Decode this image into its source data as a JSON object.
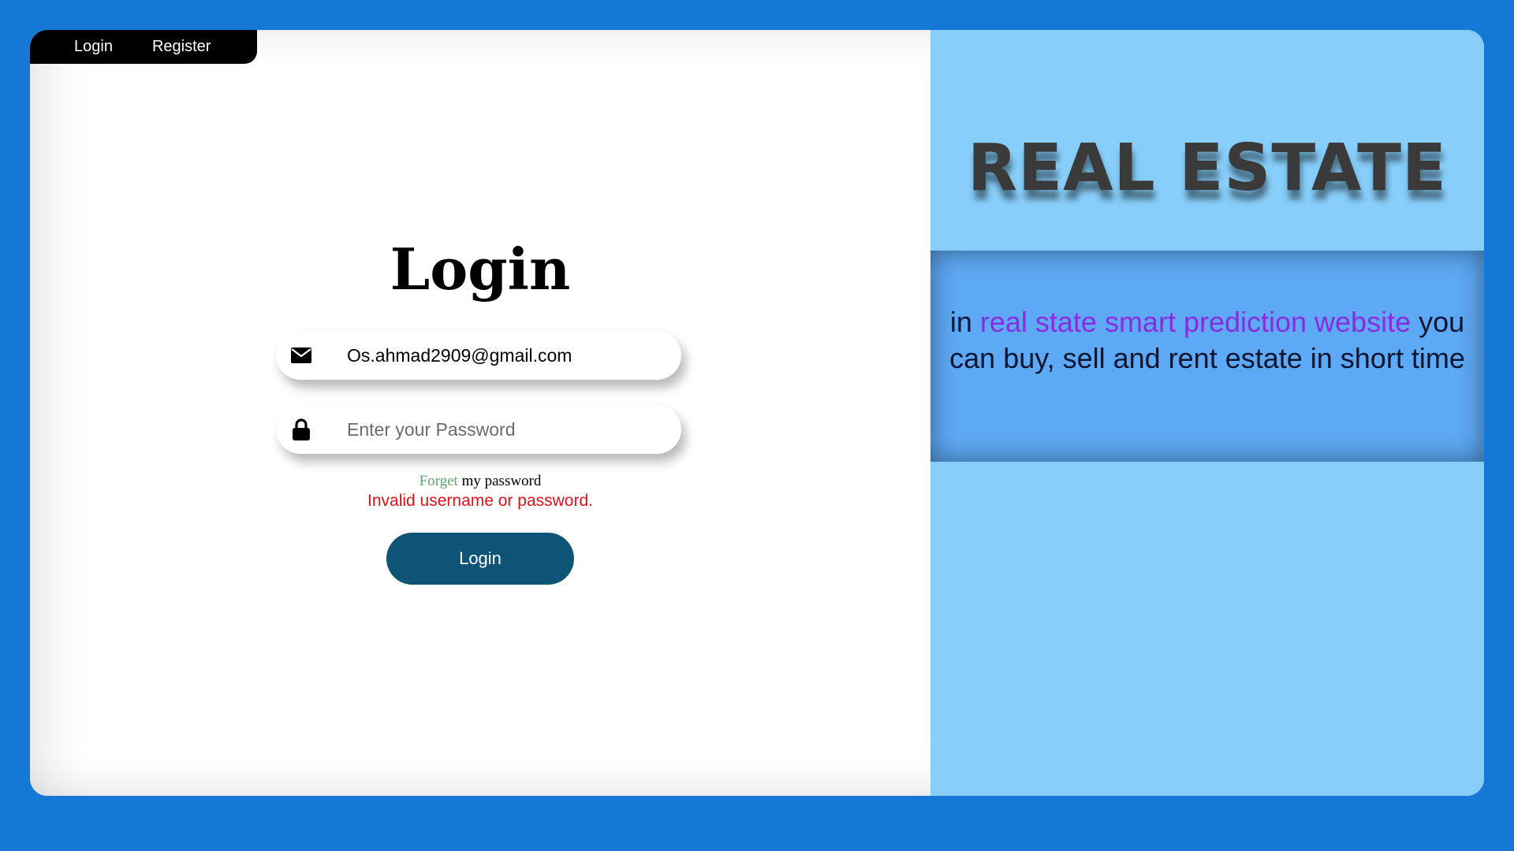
{
  "nav": {
    "login_label": "Login",
    "register_label": "Register"
  },
  "login_form": {
    "title": "Login",
    "email_value": "Os.ahmad2909@gmail.com",
    "password_placeholder": "Enter your Password",
    "forgot_link": "Forget",
    "forgot_rest": " my password",
    "error_message": "Invalid username or password.",
    "submit_label": "Login"
  },
  "brand": {
    "title": "REAL ESTATE",
    "tagline_prefix": "in ",
    "tagline_highlight": "real state smart prediction website",
    "tagline_rest": " you can buy, sell and rent estate in short time"
  },
  "colors": {
    "background": "#1478d4",
    "right_panel": "#87cefa",
    "tagline_box": "#5ea9f5",
    "highlight": "#8a2be2",
    "error": "#e0101a",
    "forgot_link": "#5fa36b",
    "login_button": "#0e5477",
    "nav_bar": "#000000"
  },
  "icons": {
    "email": "envelope-icon",
    "password": "lock-icon"
  }
}
